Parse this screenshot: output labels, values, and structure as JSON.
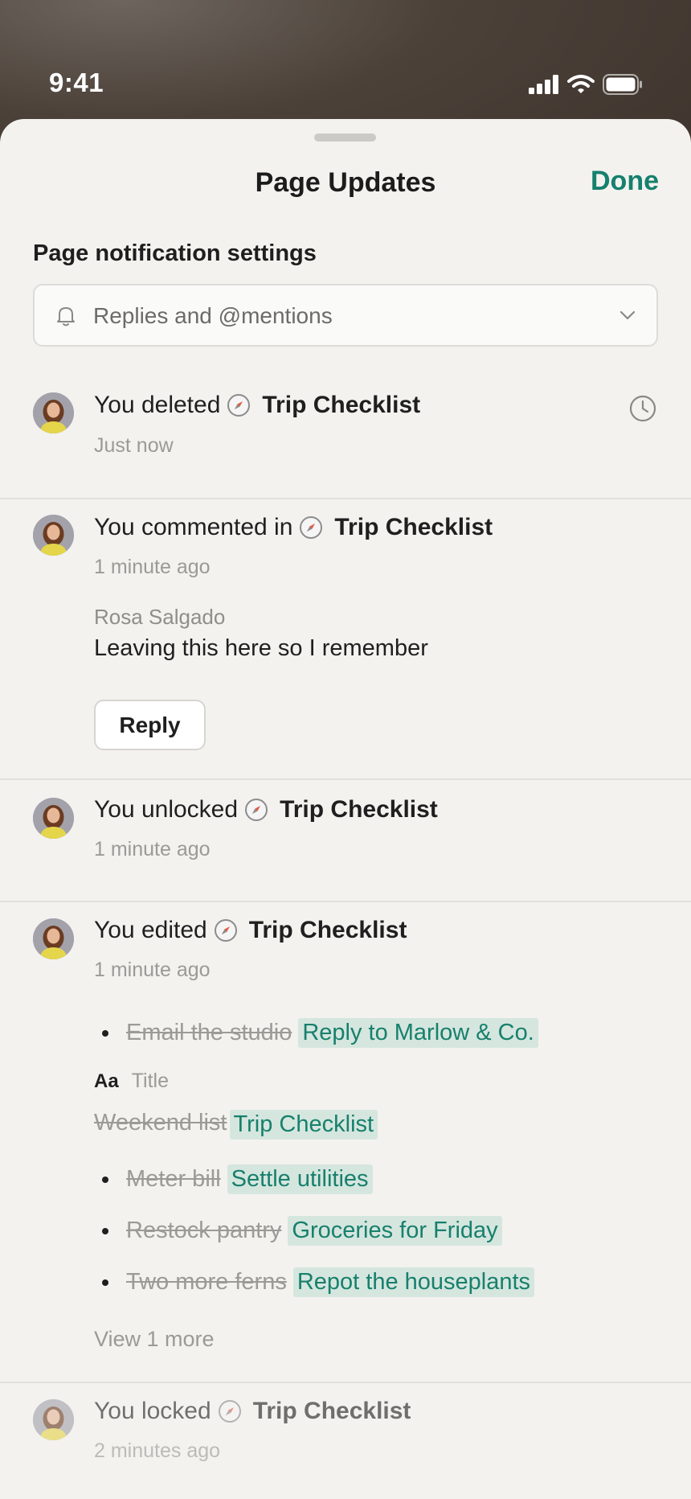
{
  "status": {
    "time": "9:41"
  },
  "header": {
    "title": "Page Updates",
    "done_label": "Done"
  },
  "settings": {
    "label": "Page notification settings",
    "selected": "Replies and @mentions"
  },
  "page_name": "Trip Checklist",
  "updates": [
    {
      "action": "You deleted",
      "time": "Just now"
    },
    {
      "action": "You commented in",
      "time": "1 minute ago",
      "comment_author": "Rosa Salgado",
      "comment_text": "Leaving this here so I remember",
      "reply_label": "Reply"
    },
    {
      "action": "You unlocked",
      "time": "1 minute ago"
    },
    {
      "action": "You edited",
      "time": "1 minute ago",
      "first_change": {
        "old": "Email the studio",
        "new": "Reply to Marlow & Co."
      },
      "property": {
        "icon_text": "Aa",
        "name": "Title"
      },
      "title_change": {
        "old": "Weekend list",
        "new": "Trip Checklist"
      },
      "bullet_changes": [
        {
          "old": "Meter bill",
          "new": "Settle utilities"
        },
        {
          "old": "Restock pantry",
          "new": "Groceries for Friday"
        },
        {
          "old": "Two more ferns",
          "new": "Repot the houseplants"
        }
      ],
      "view_more": "View 1 more"
    },
    {
      "action": "You locked",
      "time": "2 minutes ago"
    }
  ],
  "colors": {
    "accent": "#15806d",
    "added_bg": "#d5e6df",
    "sheet_bg": "#f3f2ef"
  },
  "icons": [
    "signal-icon",
    "wifi-icon",
    "battery-icon",
    "bell-icon",
    "chevron-down-icon",
    "compass-icon",
    "clock-icon",
    "avatar"
  ]
}
